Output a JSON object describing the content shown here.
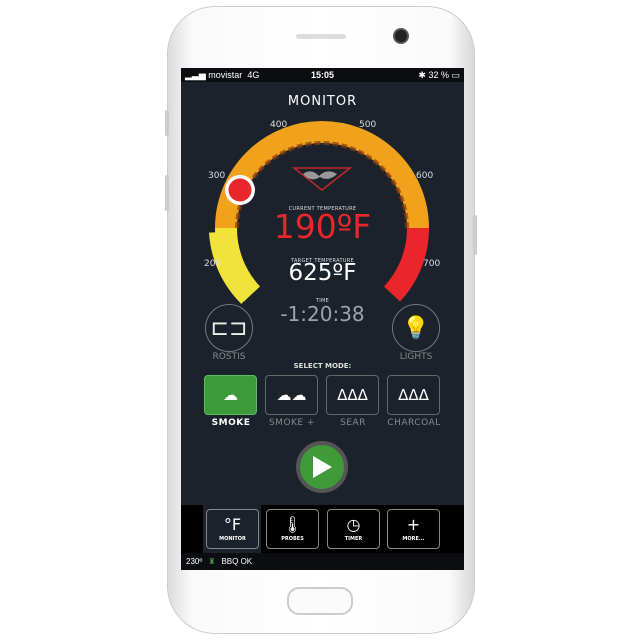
{
  "status": {
    "carrier": "movistar",
    "network": "4G",
    "time": "15:05",
    "battery": "32 %"
  },
  "header": {
    "title": "MONITOR"
  },
  "gauge": {
    "ticks": [
      "200",
      "300",
      "400",
      "500",
      "600",
      "700"
    ],
    "knob_value": 300,
    "colors": {
      "low": "#f0e33a",
      "mid": "#f0a21c",
      "high": "#e8262b"
    }
  },
  "readouts": {
    "current_label": "CURRENT TEMPERATURE",
    "current": "190ºF",
    "target_label": "TARGET TEMPERATURE",
    "target": "625ºF",
    "time_label": "TIME",
    "time": "-1:20:38"
  },
  "controls": {
    "rostis": "ROSTIS",
    "lights": "LIGHTS"
  },
  "modes": {
    "label": "SELECT MODE:",
    "items": [
      {
        "label": "SMOKE",
        "icon": "cloud-flame-icon"
      },
      {
        "label": "SMOKE +",
        "icon": "clouds-flames-icon"
      },
      {
        "label": "SEAR",
        "icon": "flames-icon"
      },
      {
        "label": "CHARCOAL",
        "icon": "charcoal-icon"
      }
    ],
    "selected": "SMOKE"
  },
  "nav": [
    {
      "label": "MONITOR",
      "icon": "°F"
    },
    {
      "label": "PROBES",
      "icon": "🌡"
    },
    {
      "label": "TIMER",
      "icon": "◷"
    },
    {
      "label": "MORE...",
      "icon": "+"
    }
  ],
  "footer": {
    "temp": "230º",
    "status": "BBQ OK"
  },
  "accent": "#3f9a3a"
}
